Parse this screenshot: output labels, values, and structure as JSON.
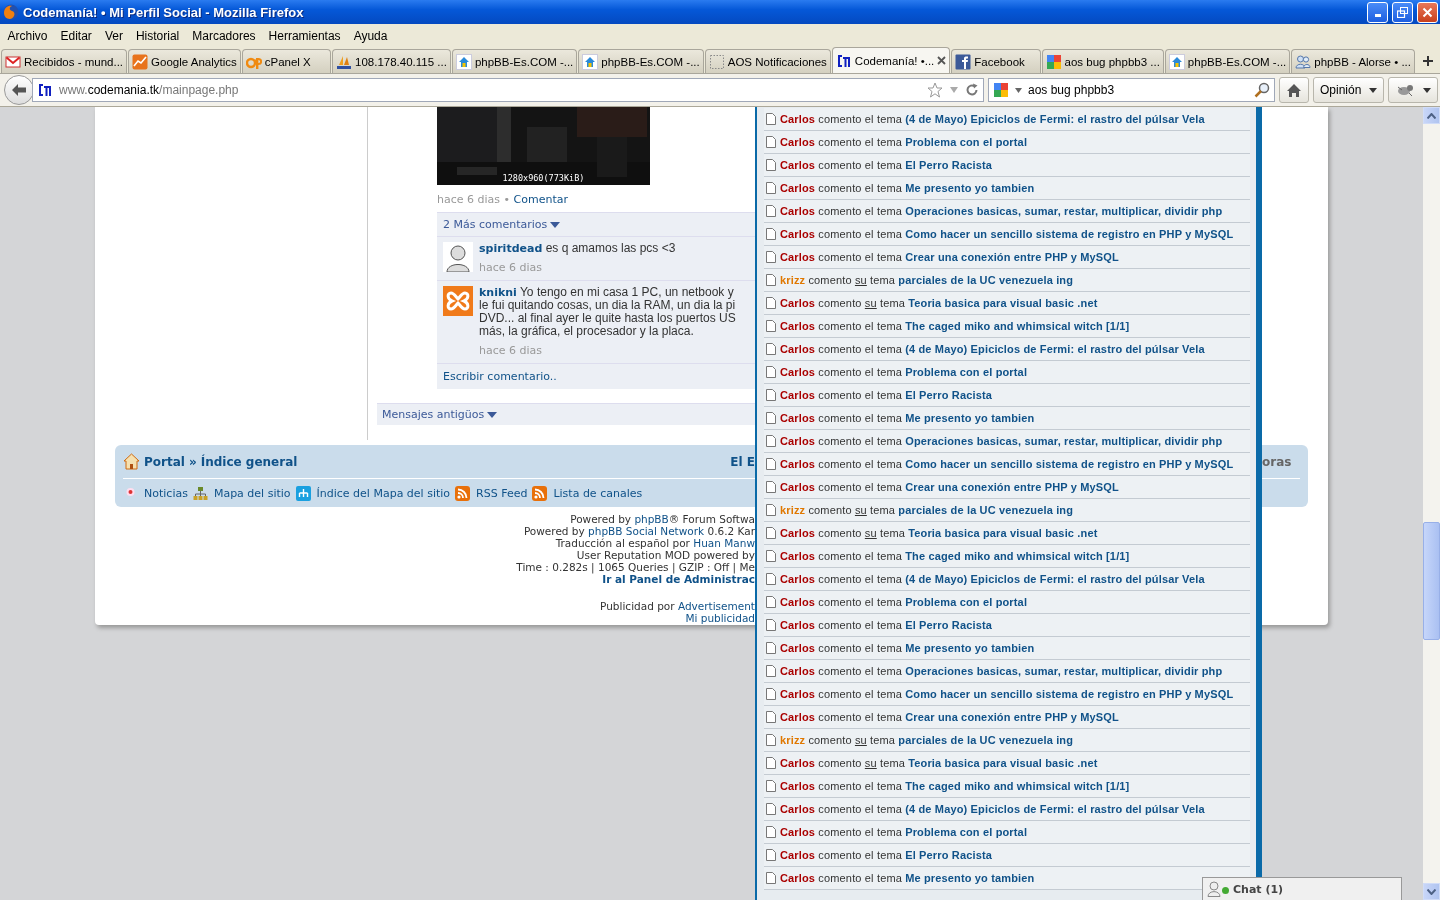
{
  "window": {
    "title": "Codemanía! • Mi Perfil Social - Mozilla Firefox"
  },
  "menu": [
    "Archivo",
    "Editar",
    "Ver",
    "Historial",
    "Marcadores",
    "Herramientas",
    "Ayuda"
  ],
  "tabs": [
    {
      "label": "Recibidos - mund...",
      "kind": "mail",
      "selected": false
    },
    {
      "label": "Google Analytics",
      "kind": "chart",
      "selected": false
    },
    {
      "label": "cPanel X",
      "kind": "panel",
      "selected": false
    },
    {
      "label": "108.178.40.115 ...",
      "kind": "sails",
      "selected": false
    },
    {
      "label": "phpBB-Es.COM -...",
      "kind": "house",
      "selected": false
    },
    {
      "label": "phpBB-Es.COM -...",
      "kind": "house",
      "selected": false
    },
    {
      "label": "AOS Notificaciones",
      "kind": "blank",
      "selected": false
    },
    {
      "label": "Codemanía! •...",
      "kind": "bracket",
      "selected": true
    },
    {
      "label": "Facebook",
      "kind": "square",
      "selected": false
    },
    {
      "label": "aos bug phpbb3 ...",
      "kind": "tiles",
      "selected": false
    },
    {
      "label": "phpBB-Es.COM -...",
      "kind": "house",
      "selected": false
    },
    {
      "label": "phpBB - Alorse • ...",
      "kind": "people",
      "selected": false
    }
  ],
  "navigation": {
    "url": {
      "prefix": "www.",
      "domain": "codemania.tk",
      "path": "/mainpage.php"
    },
    "search": {
      "value": "aos bug phpbb3"
    },
    "feedback_button": "Opinión"
  },
  "post": {
    "image_caption": "1280x960(773KiB)",
    "time": "hace 6 dias",
    "separator": "•",
    "comment_link": "Comentar",
    "more_comments": "2 Más comentarios",
    "comments": [
      {
        "user": "spiritdead",
        "kind": "silhouette",
        "lines": [
          "es q amamos las pcs <3"
        ],
        "time": "hace 6 dias"
      },
      {
        "user": "knikni",
        "kind": "logo",
        "lines": [
          "Yo tengo en mi casa 1 PC, un netbook y",
          "le fui quitando cosas, un dia la RAM, un dia la pi",
          "DVD... al final ayer le quite hasta los puertos US",
          "más, la gráfica, el procesador y la placa."
        ],
        "time": "hace 6 dias"
      }
    ],
    "write_comment": "Escribir comentario..",
    "older_messages": "Mensajes antigüos"
  },
  "footer_nav": {
    "breadcrumb": [
      "Portal",
      "Índice general"
    ],
    "separator": "»",
    "cut_text_left": "El E",
    "cut_text_right": "oras",
    "links": [
      {
        "label": "Noticias",
        "kind": "dot"
      },
      {
        "label": "Mapa del sitio",
        "kind": "sitemap"
      },
      {
        "label": "Índice del Mapa del sitio",
        "kind": "sitemap-index"
      },
      {
        "label": "RSS Feed",
        "kind": "rss"
      },
      {
        "label": "Lista de canales",
        "kind": "rss"
      }
    ]
  },
  "footer": [
    [
      {
        "text": "Powered by "
      },
      {
        "link": "phpBB"
      },
      {
        "text": "® Forum Softwa"
      }
    ],
    [
      {
        "text": "Powered by "
      },
      {
        "link": "phpBB Social Network"
      },
      {
        "text": " 0.6.2 Kar"
      }
    ],
    [
      {
        "text": "Traducción al español por "
      },
      {
        "link": "Huan Manw"
      }
    ],
    [
      {
        "text": "User Reputation MOD powered by"
      }
    ],
    [
      {
        "text": "Time : 0.282s | 1065 Queries | GZIP : Off | Me"
      }
    ],
    [
      {
        "strong_link": "Ir al Panel de Administrac"
      }
    ],
    [
      {
        "text": "Publicidad por "
      },
      {
        "link": "Advertisement"
      }
    ],
    [
      {
        "link": "Mi publicidad"
      }
    ]
  ],
  "notifications": [
    {
      "user": "Carlos",
      "color": "#aa0000",
      "verb": "comento",
      "article": "el",
      "underlined": false,
      "noun": "tema",
      "topic": "(4 de Mayo) Epiciclos de Fermi: el rastro del púlsar Vela"
    },
    {
      "user": "Carlos",
      "color": "#aa0000",
      "verb": "comento",
      "article": "el",
      "underlined": false,
      "noun": "tema",
      "topic": "Problema con el portal"
    },
    {
      "user": "Carlos",
      "color": "#aa0000",
      "verb": "comento",
      "article": "el",
      "underlined": false,
      "noun": "tema",
      "topic": "El Perro Racista"
    },
    {
      "user": "Carlos",
      "color": "#aa0000",
      "verb": "comento",
      "article": "el",
      "underlined": false,
      "noun": "tema",
      "topic": "Me presento yo tambien"
    },
    {
      "user": "Carlos",
      "color": "#aa0000",
      "verb": "comento",
      "article": "el",
      "underlined": false,
      "noun": "tema",
      "topic": "Operaciones basicas, sumar, restar, multiplicar, dividir php"
    },
    {
      "user": "Carlos",
      "color": "#aa0000",
      "verb": "comento",
      "article": "el",
      "underlined": false,
      "noun": "tema",
      "topic": "Como hacer un sencillo sistema de registro en PHP y MySQL"
    },
    {
      "user": "Carlos",
      "color": "#aa0000",
      "verb": "comento",
      "article": "el",
      "underlined": false,
      "noun": "tema",
      "topic": "Crear una conexión entre PHP y MySQL"
    },
    {
      "user": "krizz",
      "color": "#e07800",
      "verb": "comento",
      "article": "su",
      "underlined": true,
      "noun": "tema",
      "topic": "parciales de la UC venezuela ing"
    },
    {
      "user": "Carlos",
      "color": "#aa0000",
      "verb": "comento",
      "article": "su",
      "underlined": true,
      "noun": "tema",
      "topic": "Teoria basica para visual basic .net"
    },
    {
      "user": "Carlos",
      "color": "#aa0000",
      "verb": "comento",
      "article": "el",
      "underlined": false,
      "noun": "tema",
      "topic": "The caged miko and whimsical witch [1/1]"
    },
    {
      "user": "Carlos",
      "color": "#aa0000",
      "verb": "comento",
      "article": "el",
      "underlined": false,
      "noun": "tema",
      "topic": "(4 de Mayo) Epiciclos de Fermi: el rastro del púlsar Vela"
    },
    {
      "user": "Carlos",
      "color": "#aa0000",
      "verb": "comento",
      "article": "el",
      "underlined": false,
      "noun": "tema",
      "topic": "Problema con el portal"
    },
    {
      "user": "Carlos",
      "color": "#aa0000",
      "verb": "comento",
      "article": "el",
      "underlined": false,
      "noun": "tema",
      "topic": "El Perro Racista"
    },
    {
      "user": "Carlos",
      "color": "#aa0000",
      "verb": "comento",
      "article": "el",
      "underlined": false,
      "noun": "tema",
      "topic": "Me presento yo tambien"
    },
    {
      "user": "Carlos",
      "color": "#aa0000",
      "verb": "comento",
      "article": "el",
      "underlined": false,
      "noun": "tema",
      "topic": "Operaciones basicas, sumar, restar, multiplicar, dividir php"
    },
    {
      "user": "Carlos",
      "color": "#aa0000",
      "verb": "comento",
      "article": "el",
      "underlined": false,
      "noun": "tema",
      "topic": "Como hacer un sencillo sistema de registro en PHP y MySQL"
    },
    {
      "user": "Carlos",
      "color": "#aa0000",
      "verb": "comento",
      "article": "el",
      "underlined": false,
      "noun": "tema",
      "topic": "Crear una conexión entre PHP y MySQL"
    },
    {
      "user": "krizz",
      "color": "#e07800",
      "verb": "comento",
      "article": "su",
      "underlined": true,
      "noun": "tema",
      "topic": "parciales de la UC venezuela ing"
    },
    {
      "user": "Carlos",
      "color": "#aa0000",
      "verb": "comento",
      "article": "su",
      "underlined": true,
      "noun": "tema",
      "topic": "Teoria basica para visual basic .net"
    },
    {
      "user": "Carlos",
      "color": "#aa0000",
      "verb": "comento",
      "article": "el",
      "underlined": false,
      "noun": "tema",
      "topic": "The caged miko and whimsical witch [1/1]"
    },
    {
      "user": "Carlos",
      "color": "#aa0000",
      "verb": "comento",
      "article": "el",
      "underlined": false,
      "noun": "tema",
      "topic": "(4 de Mayo) Epiciclos de Fermi: el rastro del púlsar Vela"
    },
    {
      "user": "Carlos",
      "color": "#aa0000",
      "verb": "comento",
      "article": "el",
      "underlined": false,
      "noun": "tema",
      "topic": "Problema con el portal"
    },
    {
      "user": "Carlos",
      "color": "#aa0000",
      "verb": "comento",
      "article": "el",
      "underlined": false,
      "noun": "tema",
      "topic": "El Perro Racista"
    },
    {
      "user": "Carlos",
      "color": "#aa0000",
      "verb": "comento",
      "article": "el",
      "underlined": false,
      "noun": "tema",
      "topic": "Me presento yo tambien"
    },
    {
      "user": "Carlos",
      "color": "#aa0000",
      "verb": "comento",
      "article": "el",
      "underlined": false,
      "noun": "tema",
      "topic": "Operaciones basicas, sumar, restar, multiplicar, dividir php"
    },
    {
      "user": "Carlos",
      "color": "#aa0000",
      "verb": "comento",
      "article": "el",
      "underlined": false,
      "noun": "tema",
      "topic": "Como hacer un sencillo sistema de registro en PHP y MySQL"
    },
    {
      "user": "Carlos",
      "color": "#aa0000",
      "verb": "comento",
      "article": "el",
      "underlined": false,
      "noun": "tema",
      "topic": "Crear una conexión entre PHP y MySQL"
    },
    {
      "user": "krizz",
      "color": "#e07800",
      "verb": "comento",
      "article": "su",
      "underlined": true,
      "noun": "tema",
      "topic": "parciales de la UC venezuela ing"
    },
    {
      "user": "Carlos",
      "color": "#aa0000",
      "verb": "comento",
      "article": "su",
      "underlined": true,
      "noun": "tema",
      "topic": "Teoria basica para visual basic .net"
    },
    {
      "user": "Carlos",
      "color": "#aa0000",
      "verb": "comento",
      "article": "el",
      "underlined": false,
      "noun": "tema",
      "topic": "The caged miko and whimsical witch [1/1]"
    },
    {
      "user": "Carlos",
      "color": "#aa0000",
      "verb": "comento",
      "article": "el",
      "underlined": false,
      "noun": "tema",
      "topic": "(4 de Mayo) Epiciclos de Fermi: el rastro del púlsar Vela"
    },
    {
      "user": "Carlos",
      "color": "#aa0000",
      "verb": "comento",
      "article": "el",
      "underlined": false,
      "noun": "tema",
      "topic": "Problema con el portal"
    },
    {
      "user": "Carlos",
      "color": "#aa0000",
      "verb": "comento",
      "article": "el",
      "underlined": false,
      "noun": "tema",
      "topic": "El Perro Racista"
    },
    {
      "user": "Carlos",
      "color": "#aa0000",
      "verb": "comento",
      "article": "el",
      "underlined": false,
      "noun": "tema",
      "topic": "Me presento yo tambien"
    }
  ],
  "chat": {
    "label": "Chat (1)",
    "online": true
  }
}
